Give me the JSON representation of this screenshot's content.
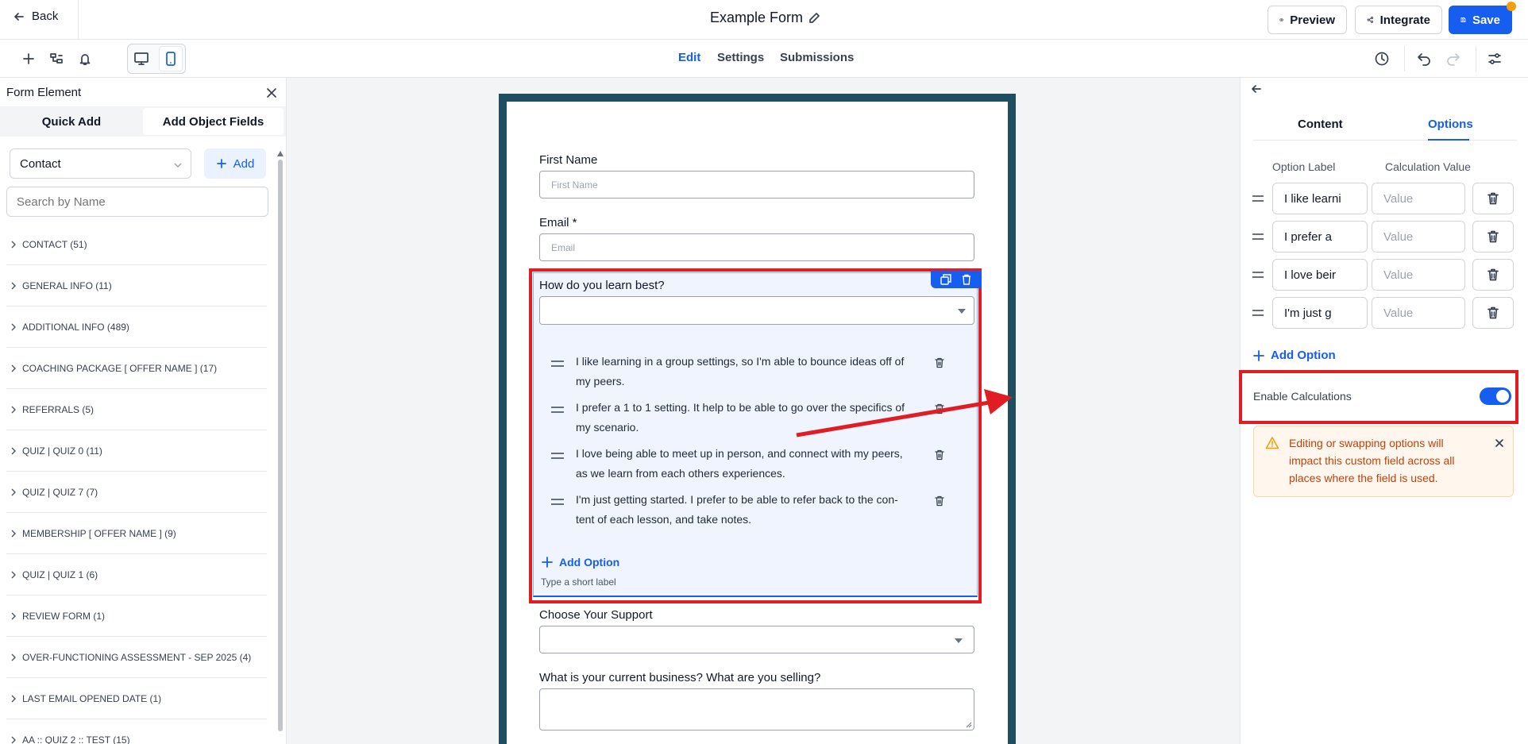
{
  "topbar": {
    "back_label": "Back",
    "form_title": "Example Form",
    "preview_label": "Preview",
    "integrate_label": "Integrate",
    "save_label": "Save"
  },
  "toolbar": {
    "tabs": [
      {
        "label": "Edit"
      },
      {
        "label": "Settings"
      },
      {
        "label": "Submissions"
      }
    ]
  },
  "left_panel": {
    "title": "Form Element",
    "tabs": [
      {
        "label": "Quick Add"
      },
      {
        "label": "Add Object Fields"
      }
    ],
    "object_select": "Contact",
    "add_label": "Add",
    "search_placeholder": "Search by Name",
    "categories": [
      {
        "label": "CONTACT (51)"
      },
      {
        "label": "GENERAL INFO (11)"
      },
      {
        "label": "ADDITIONAL INFO (489)"
      },
      {
        "label": "COACHING PACKAGE [ OFFER NAME ] (17)"
      },
      {
        "label": "REFERRALS (5)"
      },
      {
        "label": "QUIZ | QUIZ 0 (11)"
      },
      {
        "label": "QUIZ | QUIZ 7 (7)"
      },
      {
        "label": "MEMBERSHIP [ OFFER NAME ] (9)"
      },
      {
        "label": "QUIZ | QUIZ 1 (6)"
      },
      {
        "label": "REVIEW FORM (1)"
      },
      {
        "label": "OVER-FUNCTIONING ASSESSMENT - SEP 2025 (4)"
      },
      {
        "label": "LAST EMAIL OPENED DATE (1)"
      },
      {
        "label": "AA :: QUIZ 2 :: TEST (15)"
      }
    ]
  },
  "form": {
    "first_name_label": "First Name",
    "first_name_placeholder": "First Name",
    "email_label": "Email *",
    "email_placeholder": "Email",
    "question_label": "How do you learn best?",
    "options": [
      {
        "line1": "I like learning in a group settings, so I'm able to bounce ideas off of",
        "line2": "my peers."
      },
      {
        "line1": "I prefer a 1 to 1 setting. It help to be able to go over the specifics of",
        "line2": "my scenario."
      },
      {
        "line1": "I love being able to meet up in person, and connect with my peers,",
        "line2": "as we learn from each others experiences."
      },
      {
        "line1": "I'm just getting started. I prefer to be able to refer back to the con-",
        "line2": "tent of each lesson, and take notes."
      }
    ],
    "add_option_label": "Add Option",
    "short_label_hint": "Type a short label",
    "support_label": "Choose Your Support",
    "business_label": "What is your current business? What are you selling?"
  },
  "right_panel": {
    "tabs": [
      {
        "label": "Content"
      },
      {
        "label": "Options"
      }
    ],
    "col_option": "Option Label",
    "col_calc": "Calculation Value",
    "rows": [
      {
        "label": "I like learni",
        "value_placeholder": "Value"
      },
      {
        "label": "I prefer a",
        "value_placeholder": "Value"
      },
      {
        "label": "I love beir",
        "value_placeholder": "Value"
      },
      {
        "label": "I'm just g",
        "value_placeholder": "Value"
      }
    ],
    "add_option_label": "Add Option",
    "enable_calc_label": "Enable Calculations",
    "enable_calc_on": true,
    "warning_text": "Editing or swapping options will impact this custom field across all places where the field is used."
  },
  "colors": {
    "accent": "#155eef",
    "annotation": "#e11d24",
    "form_border": "#1f4e61",
    "warning_bg": "#fff7ed",
    "warning_text": "#c2410c"
  }
}
